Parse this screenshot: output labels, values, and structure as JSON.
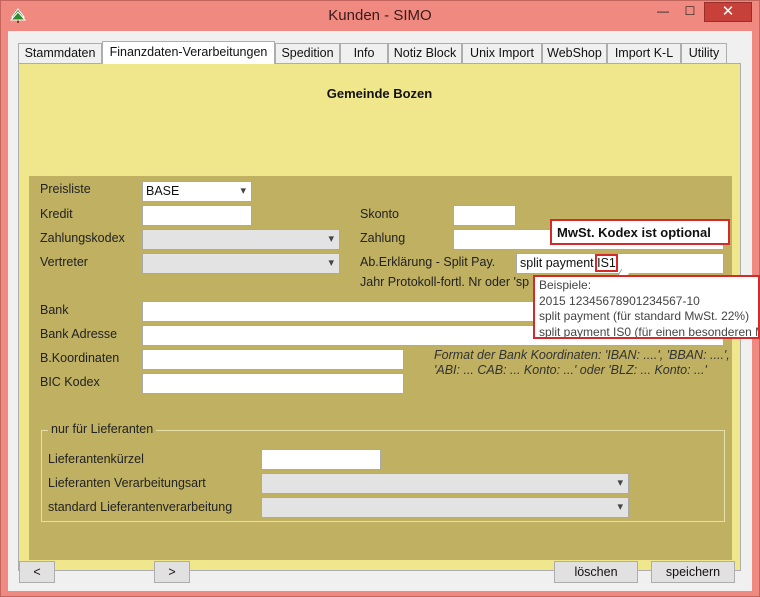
{
  "window": {
    "title": "Kunden - SIMO",
    "min_glyph": "—",
    "max_glyph": "☐",
    "close_glyph": "✕"
  },
  "tabs": [
    {
      "label": "Stammdaten"
    },
    {
      "label": "Finanzdaten-Verarbeitungen"
    },
    {
      "label": "Spedition"
    },
    {
      "label": "Info"
    },
    {
      "label": "Notiz Block"
    },
    {
      "label": "Unix Import"
    },
    {
      "label": "WebShop"
    },
    {
      "label": "Import K-L"
    },
    {
      "label": "Utility"
    }
  ],
  "heading": "Gemeinde Bozen",
  "form": {
    "preisliste_label": "Preisliste",
    "preisliste_value": "BASE",
    "kredit_label": "Kredit",
    "kredit_value": "",
    "skonto_label": "Skonto",
    "skonto_value": "",
    "zahlungskodex_label": "Zahlungskodex",
    "zahlungskodex_value": "",
    "zahlung_label": "Zahlung",
    "zahlung_value": "",
    "vertreter_label": "Vertreter",
    "vertreter_value": "",
    "split_label": "Ab.Erklärung - Split Pay.",
    "split_value_prefix": "split payment ",
    "split_value_code": "IS1",
    "jahr_label": "Jahr Protokoll-fortl. Nr oder 'sp",
    "bank_label": "Bank",
    "bank_value": "",
    "bank_adresse_label": "Bank Adresse",
    "bank_adresse_value": "",
    "koordinaten_label": "B.Koordinaten",
    "koordinaten_value": "",
    "bic_label": "BIC Kodex",
    "bic_value": "",
    "format_hint": "Format der Bank Koordinaten: 'IBAN: ....', 'BBAN: ....', 'ABI: ... CAB: ... Konto: ...'  oder 'BLZ: ... Konto: ...'"
  },
  "lieferanten": {
    "legend": "nur für Lieferanten",
    "kuerzel_label": "Lieferantenkürzel",
    "kuerzel_value": "",
    "verarbeitungsart_label": "Lieferanten Verarbeitungsart",
    "verarbeitungsart_value": "",
    "standard_label": "standard Lieferantenverarbeitung",
    "standard_value": ""
  },
  "callout": "MwSt. Kodex ist optional",
  "tooltip": {
    "line1": "Beispiele:",
    "line2": "2015 12345678901234567-10",
    "line3": "split payment (für standard  MwSt. 22%)",
    "line4": "split payment IS0 (für einen besonderen M"
  },
  "buttons": {
    "prev": "<",
    "next": ">",
    "delete": "löschen",
    "save": "speichern"
  },
  "colors": {
    "window_frame": "#f08a80",
    "panel_bg": "#f0e68c",
    "form_bg": "#bfb062",
    "highlight": "#d42a2a"
  }
}
